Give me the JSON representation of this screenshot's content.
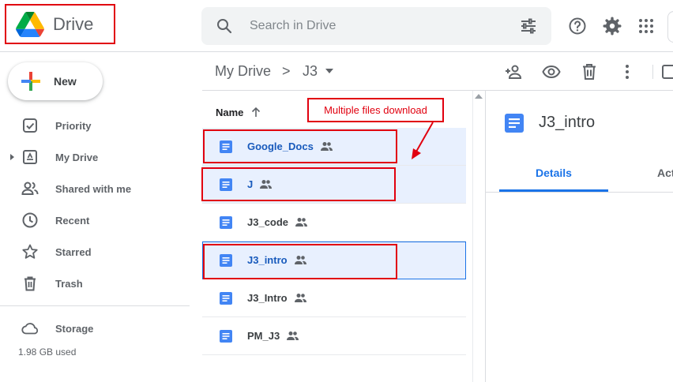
{
  "app": {
    "name": "Drive"
  },
  "search": {
    "placeholder": "Search in Drive"
  },
  "new_button": {
    "label": "New"
  },
  "sidebar": {
    "items": [
      {
        "label": "Priority",
        "icon": "priority-icon"
      },
      {
        "label": "My Drive",
        "icon": "my-drive-icon"
      },
      {
        "label": "Shared with me",
        "icon": "shared-with-me-icon"
      },
      {
        "label": "Recent",
        "icon": "recent-icon"
      },
      {
        "label": "Starred",
        "icon": "star-icon"
      },
      {
        "label": "Trash",
        "icon": "trash-icon"
      },
      {
        "label": "Storage",
        "icon": "cloud-icon"
      }
    ],
    "storage_used": "1.98 GB used"
  },
  "breadcrumb": {
    "root": "My Drive",
    "separator": ">",
    "current": "J3"
  },
  "file_list": {
    "column_name": "Name",
    "sort": "ascending",
    "files": [
      {
        "name": "Google_Docs",
        "selected": true
      },
      {
        "name": "J",
        "selected": true
      },
      {
        "name": "J3_code",
        "selected": false
      },
      {
        "name": "J3_intro",
        "selected": true
      },
      {
        "name": "J3_Intro",
        "selected": false
      },
      {
        "name": "PM_J3",
        "selected": false
      }
    ]
  },
  "details_pane": {
    "title": "J3_intro",
    "tabs": [
      {
        "label": "Details",
        "active": true
      },
      {
        "label": "Act"
      }
    ]
  },
  "annotation": {
    "callout": "Multiple files download"
  },
  "colors": {
    "accent": "#1a73e8",
    "selected_row": "#e8f0fe",
    "annotation_red": "#e1000f",
    "doc_blue": "#4285f4"
  }
}
